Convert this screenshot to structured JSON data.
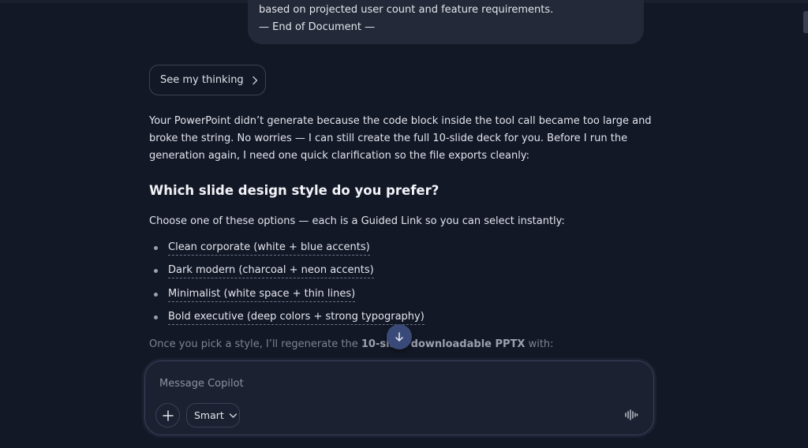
{
  "previous_message": {
    "line1": "based on projected user count and feature requirements.",
    "line2": "— End of Document —"
  },
  "thinking_button": {
    "label": "See my thinking",
    "icon": "chevron-right-icon"
  },
  "answer": {
    "line1": "Your PowerPoint didn’t generate because the code block inside the tool call became too large and",
    "line2": "broke the string. No worries — I can still create the full 10-slide deck for you. Before I run the",
    "line3": "generation again, I need one quick clarification so the file exports cleanly:"
  },
  "question_heading": "Which slide design style do you prefer?",
  "choose_text": "Choose one of these options — each is a Guided Link so you can select instantly:",
  "options": [
    "Clean corporate (white + blue accents)",
    "Dark modern (charcoal + neon accents)",
    "Minimalist (white space + thin lines)",
    "Bold executive (deep colors + strong typography)"
  ],
  "followup": {
    "prefix": "Once you pick a style, I’ll regenerate the ",
    "bold": "10-slide downloadable PPTX",
    "suffix": " with:"
  },
  "scroll_down_icon": "arrow-down-icon",
  "composer": {
    "placeholder": "Message Copilot",
    "value": "",
    "add_icon": "plus-icon",
    "mode_label": "Smart",
    "mode_icon": "chevron-down-icon",
    "voice_icon": "voice-waveform-icon"
  },
  "colors": {
    "background": "#131827",
    "composer_bg": "#1b2130",
    "scroll_button": "#3a4a78",
    "text": "#e3e5ec",
    "muted_text": "#7e8494"
  }
}
